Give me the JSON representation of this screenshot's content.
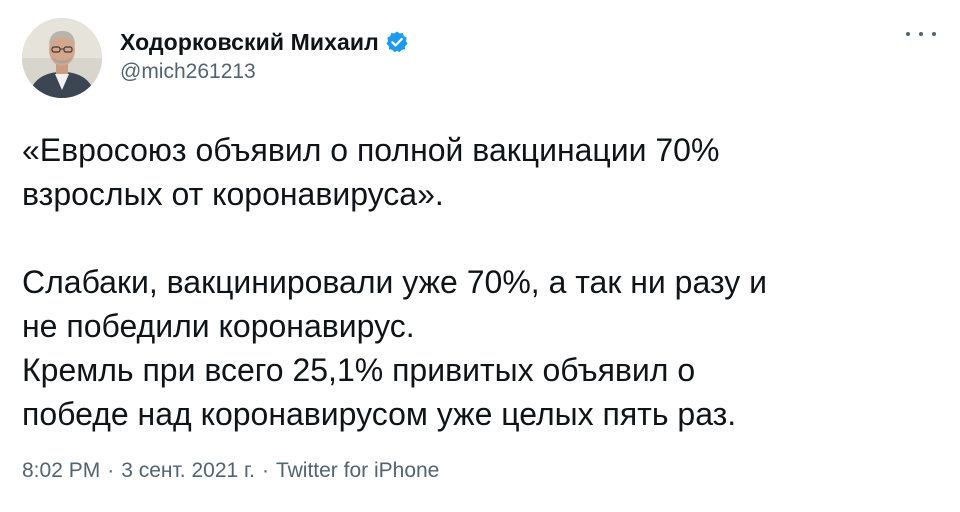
{
  "author": {
    "display_name": "Ходорковский Михаил",
    "handle": "@mich261213",
    "verified_icon": "verified-badge-icon",
    "verified_color": "#1d9bf0"
  },
  "more_icon": "more-horizontal-icon",
  "tweet": {
    "paragraph1_line1": "«Евросоюз объявил о полной вакцинации 70%",
    "paragraph1_line2": "взрослых от коронавируса».",
    "paragraph2_line1": "Слабаки, вакцинировали уже 70%, а так ни разу и",
    "paragraph2_line2": "не победили коронавирус.",
    "paragraph3_line1": "Кремль при всего 25,1% привитых объявил о",
    "paragraph3_line2": "победе над коронавирусом уже целых пять раз."
  },
  "meta": {
    "time": "8:02 PM",
    "separator": "·",
    "date": "3 сент. 2021 г.",
    "source": "Twitter for iPhone"
  },
  "colors": {
    "text": "#0f1419",
    "secondary": "#536471",
    "background": "#ffffff"
  }
}
